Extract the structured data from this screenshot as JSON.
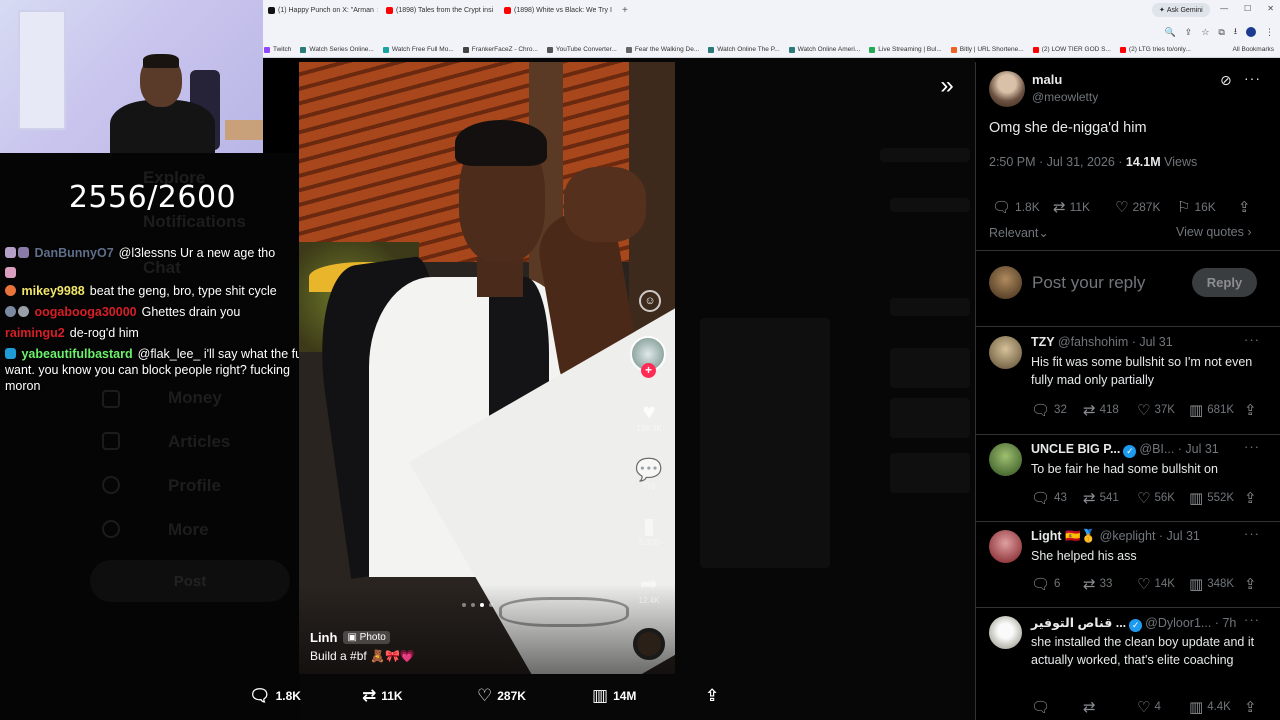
{
  "browser": {
    "tabs": [
      {
        "label": "(1) Happy Punch on X: \"Arman",
        "color": "#111111"
      },
      {
        "label": "(1898) Tales from the Crypt insi",
        "color": "#ff0000"
      },
      {
        "label": "(1898) White vs Black: We Try I",
        "color": "#ff0000"
      }
    ],
    "new_tab": "+",
    "gemini_label": "Ask Gemini",
    "bookmarks": [
      {
        "label": "Twitch",
        "color": "#9146ff"
      },
      {
        "label": "Watch Series Online...",
        "color": "#2b7a78"
      },
      {
        "label": "Watch Free Full Mo...",
        "color": "#1aa3a3"
      },
      {
        "label": "FrankerFaceZ - Chro...",
        "color": "#444444"
      },
      {
        "label": "YouTube Converter...",
        "color": "#555555"
      },
      {
        "label": "Fear the Walking De...",
        "color": "#666666"
      },
      {
        "label": "Watch Online The P...",
        "color": "#2b7a78"
      },
      {
        "label": "Watch Online Ameri...",
        "color": "#2b7a78"
      },
      {
        "label": "Live Streaming | Bul...",
        "color": "#22aa55"
      },
      {
        "label": "Bitly | URL Shortene...",
        "color": "#ee6123"
      },
      {
        "label": "(2) LOW TIER GOD S...",
        "color": "#ff0000"
      },
      {
        "label": "(2) LTG tries to/only...",
        "color": "#ff0000"
      }
    ],
    "all_bookmarks": "All Bookmarks"
  },
  "stream": {
    "counter": "2556/2600",
    "chat": [
      {
        "user": "DanBunnyO7",
        "user_color": "#5f6f8a",
        "message": "@l3lessns Ur a new age tho",
        "badge_color": "#b7a0c8"
      },
      {
        "user": "mikey9988",
        "user_color": "#f2e66c",
        "message": "beat the geng, bro, type shit cycle",
        "badge_color": "#e8743b"
      },
      {
        "user": "oogabooga30000",
        "user_color": "#d81f26",
        "message": "Ghettes drain you",
        "badge_color": "#7a8aa0"
      },
      {
        "user": "raimingu2",
        "user_color": "#d81f26",
        "message": "de-rog'd him",
        "badge_color": ""
      },
      {
        "user": "yabeautifulbastard",
        "user_color": "#6cf26c",
        "message": "@flak_lee_ i'll say what the fuck i want. you know you can block people right? fucking moron",
        "badge_color": "#1f9bd6"
      }
    ]
  },
  "background_nav": {
    "items": [
      "Explore",
      "Notifications",
      "Chat",
      "Money",
      "Articles",
      "Profile",
      "More"
    ],
    "post_label": "Post"
  },
  "media": {
    "tiktok_user": "Linh",
    "tiktok_tag": "Photo",
    "tiktok_caption": "Build a #bf 🧸🎀💗",
    "likes_small": "136.3K",
    "comments_small": "776",
    "saves_small": "5,370",
    "shares_small": "12.4K",
    "slide_count": 4,
    "active_slide": 3,
    "actions": {
      "replies": "1.8K",
      "reposts": "11K",
      "likes": "287K",
      "views": "14M"
    }
  },
  "tweet": {
    "name": "malu",
    "handle": "@meowletty",
    "text": "Omg she de-nigga'd him",
    "time": "2:50 PM · Jul 31, 2026",
    "views_count": "14.1M",
    "views_label": "Views",
    "stats": {
      "replies": "1.8K",
      "reposts": "11K",
      "likes": "287K",
      "bookmarks": "16K"
    },
    "sort_label": "Relevant",
    "view_quotes": "View quotes",
    "reply_placeholder": "Post your reply",
    "reply_button": "Reply"
  },
  "replies": [
    {
      "name": "TZY",
      "handle": "@fahshohim · Jul 31",
      "text": "His fit was some bullshit so I'm not even fully mad only partially",
      "comments": "32",
      "reposts": "418",
      "likes": "37K",
      "views": "681K",
      "avatar": "#9a8a70",
      "verified": false
    },
    {
      "name": "UNCLE BIG P...",
      "handle": "@BI... · Jul 31",
      "text": "To be fair he had some bullshit on",
      "comments": "43",
      "reposts": "541",
      "likes": "56K",
      "views": "552K",
      "avatar": "#4a7a3a",
      "verified": true
    },
    {
      "name": "Light 🇪🇸🥇",
      "handle": "@keplight · Jul 31",
      "text": "She helped his ass",
      "comments": "6",
      "reposts": "33",
      "likes": "14K",
      "views": "348K",
      "avatar": "#c0303a",
      "verified": false
    },
    {
      "name": "قناص التوفير ...",
      "handle": "@Dyloor1... · 7h",
      "text": "she installed the clean boy update and it actually worked, that's elite coaching",
      "comments": "",
      "reposts": "",
      "likes": "4",
      "views": "4.4K",
      "avatar": "#e8e8e8",
      "verified": true
    }
  ]
}
